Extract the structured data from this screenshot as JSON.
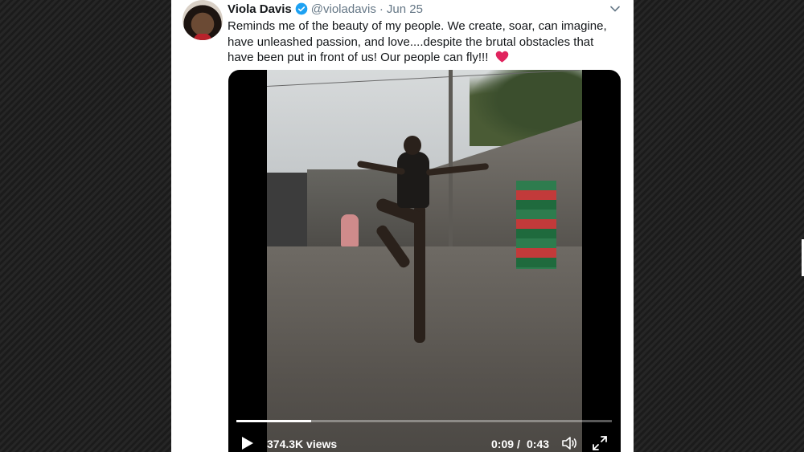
{
  "tweet": {
    "author_name": "Viola Davis",
    "handle": "@violadavis",
    "separator": "·",
    "date": "Jun 25",
    "text": "Reminds me of the beauty of my people. We create, soar, can imagine, have unleashed passion, and love....despite the brutal obstacles that have been put in front of us! Our people can fly!!!"
  },
  "video": {
    "views": "374.3K views",
    "current_time": "0:09",
    "time_separator": "/",
    "duration": "0:43",
    "progress_fraction": 0.2
  },
  "icons": {
    "verified": "verified-badge-icon",
    "caret": "chevron-down-icon",
    "heart": "red-heart-emoji",
    "play": "play-icon",
    "volume": "volume-icon",
    "fullscreen": "fullscreen-icon"
  },
  "colors": {
    "verified_blue": "#1da1f2",
    "secondary_text": "#657786",
    "heart_red": "#e0245e"
  }
}
